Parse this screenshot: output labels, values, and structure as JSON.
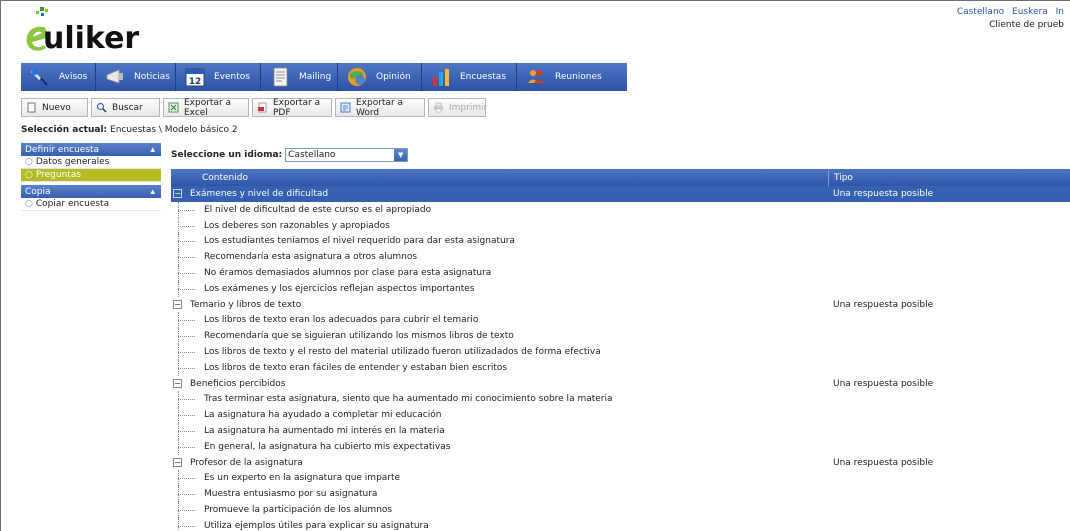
{
  "header": {
    "logo_text": "uliker",
    "languages": [
      "Castellano",
      "Euskera",
      "In"
    ],
    "client": "Cliente de prueb"
  },
  "nav": [
    {
      "label": "Avisos",
      "icon": "pin-icon"
    },
    {
      "label": "Noticias",
      "icon": "megaphone-icon"
    },
    {
      "label": "Eventos",
      "icon": "calendar-icon",
      "badge": "12"
    },
    {
      "label": "Mailing",
      "icon": "document-icon"
    },
    {
      "label": "Opinión",
      "icon": "globe-icon"
    },
    {
      "label": "Encuestas",
      "icon": "bar-chart-icon"
    },
    {
      "label": "Reuniones",
      "icon": "people-icon"
    }
  ],
  "toolbar": [
    {
      "label": "Nuevo",
      "icon": "new-document-icon",
      "enabled": true
    },
    {
      "label": "Buscar",
      "icon": "magnifier-icon",
      "enabled": true
    },
    {
      "label": "Exportar a Excel",
      "icon": "excel-icon",
      "enabled": true
    },
    {
      "label": "Exportar a PDF",
      "icon": "pdf-icon",
      "enabled": true
    },
    {
      "label": "Exportar a Word",
      "icon": "word-icon",
      "enabled": true
    },
    {
      "label": "Imprimir",
      "icon": "printer-icon",
      "enabled": false
    }
  ],
  "breadcrumb": {
    "label": "Selección actual:",
    "path": "Encuestas \\ Modelo básico 2"
  },
  "sidebar": {
    "sections": [
      {
        "title": "Definir encuesta",
        "items": [
          {
            "label": "Datos generales",
            "active": false
          },
          {
            "label": "Preguntas",
            "active": true
          }
        ]
      },
      {
        "title": "Copia",
        "items": [
          {
            "label": "Copiar encuesta",
            "active": false
          }
        ]
      }
    ]
  },
  "language_select": {
    "label": "Seleccione un idioma:",
    "value": "Castellano"
  },
  "grid": {
    "columns": [
      "Contenido",
      "Tipo"
    ],
    "groups": [
      {
        "title": "Exámenes y nivel de dificultad",
        "type": "Una respuesta posible",
        "selected": true,
        "questions": [
          "El nivel de dificultad de este curso es el apropiado",
          "Los deberes son razonables y apropiados",
          "Los estudiantes teníamos el nivel requerido para dar esta asignatura",
          "Recomendaría esta asignatura a otros alumnos",
          "No éramos demasiados alumnos por clase para esta asignatura",
          "Los exámenes y los ejercicios reflejan aspectos importantes"
        ]
      },
      {
        "title": "Temario y libros de texto",
        "type": "Una respuesta posible",
        "selected": false,
        "questions": [
          "Los libros de texto eran los adecuados para cubrir el temario",
          "Recomendaría que se siguieran utilizando los mismos libros de texto",
          "Los libros de texto y el resto del material utilizado fueron utilizadados de forma efectiva",
          "Los libros de texto eran fáciles de entender y estaban bien escritos"
        ]
      },
      {
        "title": "Beneficios percibidos",
        "type": "Una respuesta posible",
        "selected": false,
        "questions": [
          "Tras terminar esta asignatura, siento que ha aumentado mi conocimiento sobre la materia",
          "La asignatura ha ayudado a completar mi educación",
          "La asignatura ha aumentado mi interés en la materia",
          "En general, la asignatura ha cubierto mis expectativas"
        ]
      },
      {
        "title": "Profesor de la asignatura",
        "type": "Una respuesta posible",
        "selected": false,
        "questions": [
          "Es un experto en la asignatura que imparte",
          "Muestra entusiasmo por su asignatura",
          "Promueve la participación de los alumnos",
          "Utiliza ejemplos útiles para explicar su asignatura"
        ]
      }
    ]
  },
  "colors": {
    "nav": "#2c53a4",
    "active_item": "#b3bd22",
    "selected_row": "#3561b3"
  }
}
